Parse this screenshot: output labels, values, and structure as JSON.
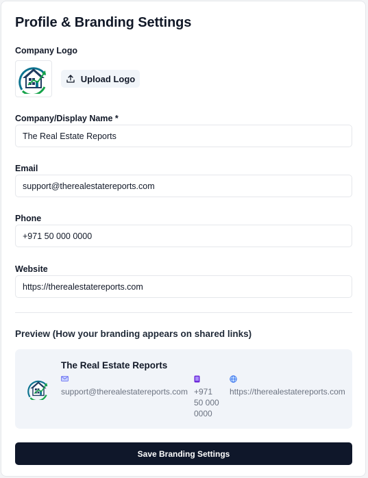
{
  "header": {
    "title": "Profile & Branding Settings"
  },
  "logo": {
    "label": "Company Logo",
    "upload_label": "Upload Logo"
  },
  "fields": {
    "name": {
      "label": "Company/Display Name *",
      "value": "The Real Estate Reports"
    },
    "email": {
      "label": "Email",
      "value": "support@therealestatereports.com"
    },
    "phone": {
      "label": "Phone",
      "value": "+971 50 000 0000"
    },
    "website": {
      "label": "Website",
      "value": "https://therealestatereports.com"
    }
  },
  "preview": {
    "heading": "Preview (How your branding appears on shared links)",
    "name": "The Real Estate Reports",
    "email": "support@therealestatereports.com",
    "phone_lines": [
      "+971",
      "50 000",
      "0000"
    ],
    "website": "https://therealestatereports.com",
    "icons": {
      "email": "email-icon",
      "phone": "phone-icon",
      "website": "globe-icon"
    }
  },
  "actions": {
    "save_label": "Save Branding Settings"
  },
  "colors": {
    "primary": "#0f172a",
    "preview_bg": "#f1f4f9",
    "logo_teal": "#0e7490",
    "logo_green": "#16a34a",
    "logo_navy": "#1e3a5f"
  }
}
